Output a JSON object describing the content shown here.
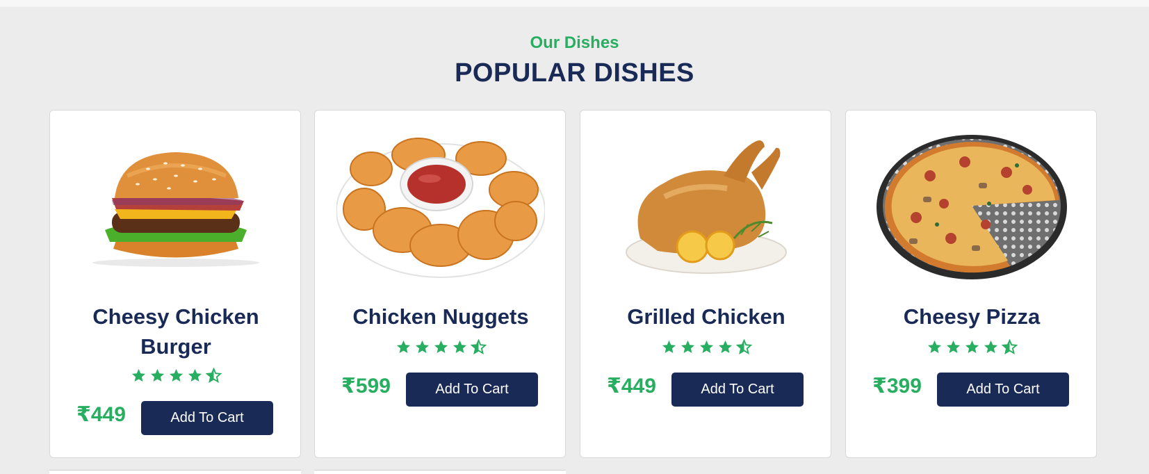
{
  "section": {
    "subtitle": "Our Dishes",
    "title": "POPULAR DISHES"
  },
  "colors": {
    "accent_green": "#27ae60",
    "navy": "#192a56",
    "background": "#ececec"
  },
  "rating": {
    "full_stars": 4,
    "half_stars": 1,
    "icon": "star-icon"
  },
  "cards": [
    {
      "name": "Cheesy Chicken Burger",
      "price": "₹449",
      "button": "Add To Cart",
      "image": "burger-image"
    },
    {
      "name": "Chicken Nuggets",
      "price": "₹599",
      "button": "Add To Cart",
      "image": "nuggets-image"
    },
    {
      "name": "Grilled Chicken",
      "price": "₹449",
      "button": "Add To Cart",
      "image": "grilled-chicken-image"
    },
    {
      "name": "Cheesy Pizza",
      "price": "₹399",
      "button": "Add To Cart",
      "image": "pizza-image"
    }
  ]
}
